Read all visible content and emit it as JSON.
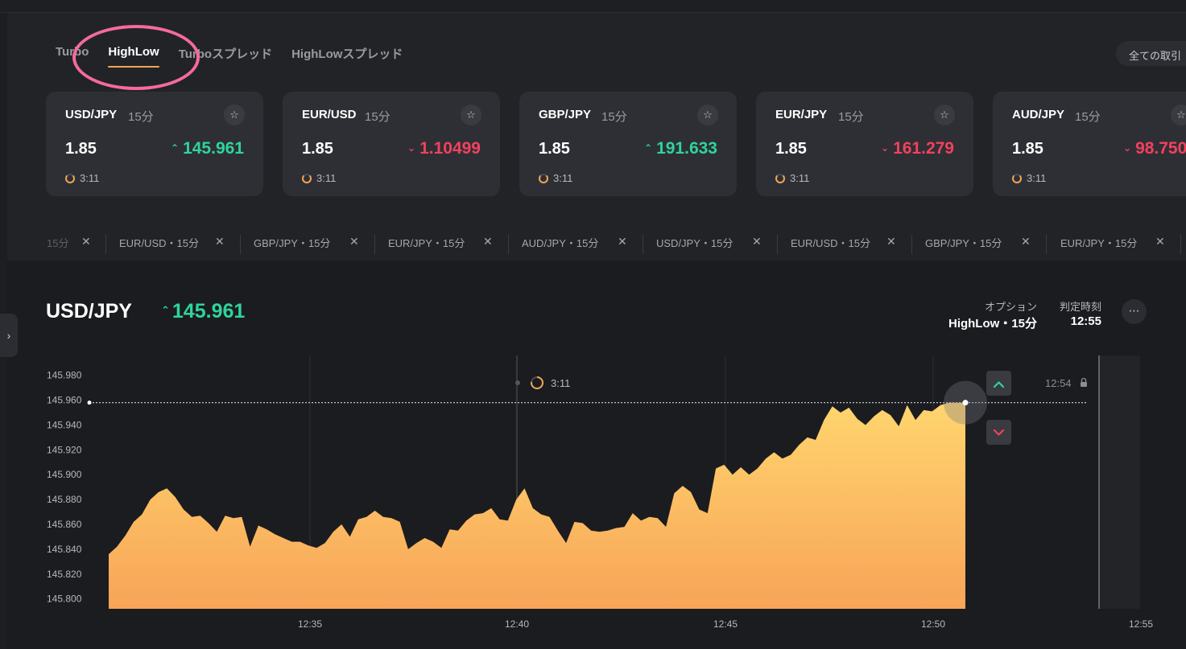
{
  "tabs": [
    {
      "label": "Turbo",
      "active": false
    },
    {
      "label": "HighLow",
      "active": true
    },
    {
      "label": "Turboスプレッド",
      "active": false
    },
    {
      "label": "HighLowスプレッド",
      "active": false
    }
  ],
  "all_trades_label": "全ての取引",
  "cards": [
    {
      "pair": "USD/JPY",
      "duration": "15分",
      "payout": "1.85",
      "rate": "145.961",
      "direction": "up",
      "timer": "3:11"
    },
    {
      "pair": "EUR/USD",
      "duration": "15分",
      "payout": "1.85",
      "rate": "1.10499",
      "direction": "down",
      "timer": "3:11"
    },
    {
      "pair": "GBP/JPY",
      "duration": "15分",
      "payout": "1.85",
      "rate": "191.633",
      "direction": "up",
      "timer": "3:11"
    },
    {
      "pair": "EUR/JPY",
      "duration": "15分",
      "payout": "1.85",
      "rate": "161.279",
      "direction": "down",
      "timer": "3:11"
    },
    {
      "pair": "AUD/JPY",
      "duration": "15分",
      "payout": "1.85",
      "rate": "98.750",
      "direction": "down",
      "timer": "3:11"
    }
  ],
  "chips": [
    "15分",
    "EUR/USD・15分",
    "GBP/JPY・15分",
    "EUR/JPY・15分",
    "AUD/JPY・15分",
    "USD/JPY・15分",
    "EUR/USD・15分",
    "GBP/JPY・15分",
    "EUR/JPY・15分"
  ],
  "chart_header": {
    "pair": "USD/JPY",
    "rate": "145.961",
    "direction": "up",
    "option_label": "オプション",
    "option_value": "HighLow・15分",
    "expiry_label": "判定時刻",
    "expiry_value": "12:55"
  },
  "icons": {
    "star": "☆",
    "close": "✕",
    "up_arrow": "⌃",
    "down_arrow": "⌄",
    "more": "⋯",
    "chevron_right": "›",
    "lock": "lock-icon"
  },
  "colors": {
    "up": "#2fd49b",
    "down": "#f2415d",
    "accent": "#f0a654",
    "area_top": "#ffd56e",
    "area_bottom": "#f8a458",
    "highlight": "#f56a9e"
  },
  "chart_data": {
    "type": "area",
    "title": "",
    "xlabel": "",
    "ylabel": "",
    "ylim": [
      145.792,
      145.996
    ],
    "yticks": [
      "145.980",
      "145.960",
      "145.940",
      "145.920",
      "145.900",
      "145.880",
      "145.860",
      "145.840",
      "145.820",
      "145.800"
    ],
    "xticks": [
      "12:35",
      "12:40",
      "12:45",
      "12:50",
      "12:55"
    ],
    "current_rate": 145.958,
    "entry_timer": "3:11",
    "cutoff_time": "12:54",
    "series": [
      {
        "minutes": [
          0.0,
          0.2,
          0.4,
          0.6,
          0.8,
          1.0,
          1.2,
          1.4,
          1.6,
          1.8,
          2.0,
          2.2,
          2.4,
          2.6,
          2.8,
          3.0,
          3.2,
          3.4,
          3.6,
          3.8,
          4.0,
          4.2,
          4.4,
          4.6,
          4.8,
          5.0,
          5.2,
          5.4,
          5.6,
          5.8,
          6.0,
          6.2,
          6.4,
          6.6,
          6.8,
          7.0,
          7.2,
          7.4,
          7.6,
          7.8,
          8.0,
          8.2,
          8.4,
          8.6,
          8.8,
          9.0,
          9.2,
          9.4,
          9.6,
          9.8,
          10.0,
          10.2,
          10.4,
          10.6,
          10.8,
          11.0,
          11.2,
          11.4,
          11.6,
          11.8,
          12.0,
          12.2,
          12.4,
          12.6,
          12.8,
          13.0,
          13.2,
          13.4,
          13.6,
          13.8,
          14.0,
          14.2,
          14.4,
          14.6,
          14.8,
          15.0,
          15.2,
          15.4,
          15.6,
          15.8,
          16.0,
          16.2,
          16.4,
          16.6,
          16.8,
          17.0,
          17.2,
          17.4,
          17.6,
          17.8,
          18.0,
          18.2,
          18.4,
          18.6,
          18.8,
          19.0,
          19.2,
          19.4,
          19.6,
          19.8,
          20.0,
          20.2,
          20.6
        ],
        "values": [
          145.836,
          145.842,
          145.851,
          145.862,
          145.868,
          145.88,
          145.886,
          145.889,
          145.882,
          145.872,
          145.866,
          145.867,
          145.861,
          145.854,
          145.867,
          145.865,
          145.866,
          145.842,
          145.859,
          145.856,
          145.852,
          145.849,
          145.846,
          145.846,
          145.843,
          145.841,
          145.845,
          145.854,
          145.86,
          145.85,
          145.864,
          145.866,
          145.871,
          145.866,
          145.865,
          145.862,
          145.84,
          145.845,
          145.849,
          145.846,
          145.841,
          145.856,
          145.855,
          145.863,
          145.868,
          145.869,
          145.873,
          145.864,
          145.863,
          145.88,
          145.889,
          145.873,
          145.868,
          145.866,
          145.855,
          145.845,
          145.862,
          145.861,
          145.855,
          145.854,
          145.855,
          145.857,
          145.858,
          145.869,
          145.863,
          145.866,
          145.865,
          145.858,
          145.885,
          145.891,
          145.886,
          145.872,
          145.869,
          145.905,
          145.908,
          145.9,
          145.906,
          145.9,
          145.905,
          145.913,
          145.918,
          145.913,
          145.916,
          145.924,
          145.93,
          145.928,
          145.944,
          145.955,
          145.95,
          145.954,
          145.945,
          145.94,
          145.947,
          145.952,
          145.948,
          145.939,
          145.956,
          145.944,
          145.952,
          145.951,
          145.956,
          145.958,
          145.958
        ]
      }
    ]
  }
}
